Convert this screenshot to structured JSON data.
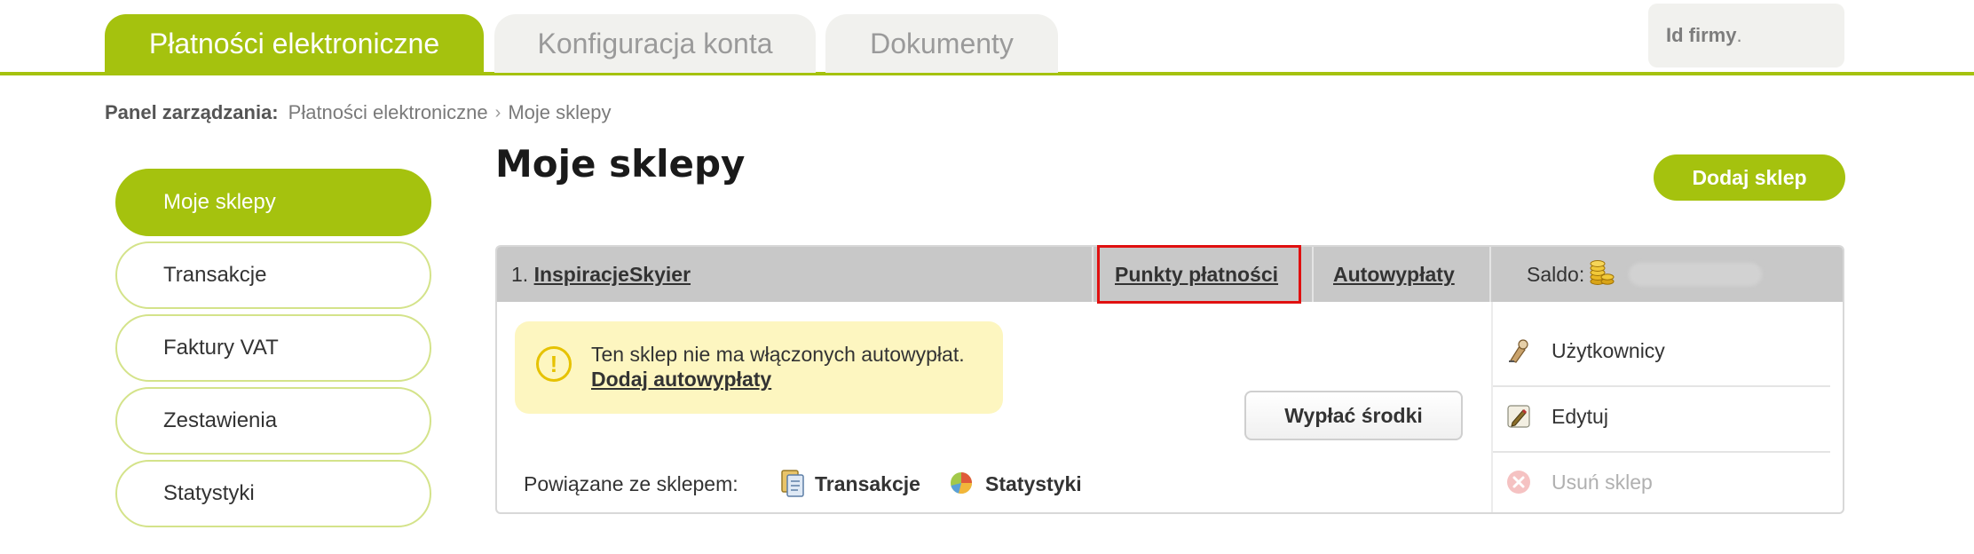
{
  "tabs": [
    {
      "label": "Płatności elektroniczne"
    },
    {
      "label": "Konfiguracja konta"
    },
    {
      "label": "Dokumenty"
    }
  ],
  "company": {
    "label": "Id firmy",
    "value": "."
  },
  "breadcrumb": {
    "label": "Panel zarządzania:",
    "link": "Płatności elektroniczne",
    "separator": "›",
    "current": "Moje sklepy"
  },
  "sidebar": {
    "items": [
      {
        "label": "Moje sklepy"
      },
      {
        "label": "Transakcje"
      },
      {
        "label": "Faktury VAT"
      },
      {
        "label": "Zestawienia"
      },
      {
        "label": "Statystyki"
      }
    ]
  },
  "page": {
    "title": "Moje sklepy",
    "add_button": "Dodaj sklep"
  },
  "shop": {
    "index": "1.",
    "name": "InspiracjeSkyier",
    "payment_points": "Punkty płatności",
    "autopayouts": "Autowypłaty",
    "saldo_label": "Saldo:",
    "notice_text": "Ten sklep nie ma włączonych autowypłat.",
    "notice_link": "Dodaj autowypłaty",
    "warning_symbol": "!",
    "withdraw_button": "Wypłać środki",
    "related_label": "Powiązane ze sklepem:",
    "related_links": [
      {
        "label": "Transakcje",
        "icon": "clipboard-icon"
      },
      {
        "label": "Statystyki",
        "icon": "pie-chart-icon"
      }
    ],
    "actions": [
      {
        "label": "Użytkownicy",
        "icon": "users-icon",
        "enabled": true
      },
      {
        "label": "Edytuj",
        "icon": "pencil-icon",
        "enabled": true
      },
      {
        "label": "Usuń sklep",
        "icon": "delete-icon",
        "enabled": false
      }
    ]
  },
  "colors": {
    "accent": "#a5c20e",
    "highlight": "#e01010",
    "notice_bg": "#fdf6c0"
  }
}
